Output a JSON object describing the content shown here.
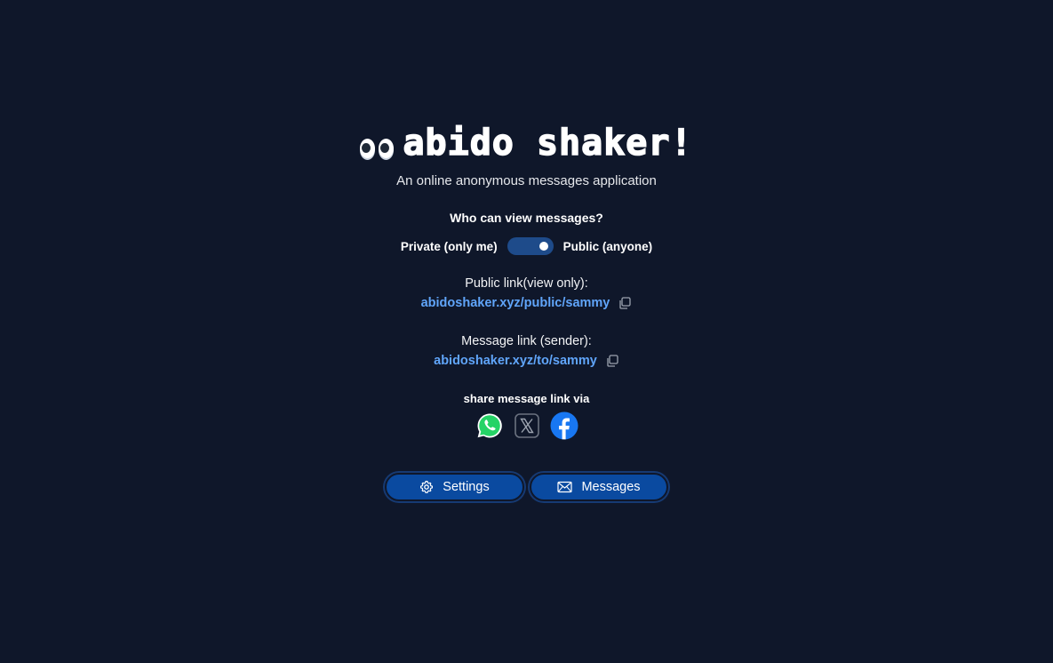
{
  "logo": {
    "text": "abido shaker!"
  },
  "tagline": "An online anonymous messages application",
  "visibility": {
    "question": "Who can view messages?",
    "private_label": "Private (only me)",
    "public_label": "Public (anyone)",
    "selected": "public"
  },
  "public_link": {
    "label": "Public link(view only):",
    "url": "abidoshaker.xyz/public/sammy",
    "icon": "copy-icon"
  },
  "message_link": {
    "label": "Message link (sender):",
    "url": "abidoshaker.xyz/to/sammy",
    "icon": "copy-icon"
  },
  "share": {
    "label": "share message link via",
    "targets": [
      {
        "name": "WhatsApp",
        "icon": "whatsapp-icon"
      },
      {
        "name": "X",
        "icon": "x-icon"
      },
      {
        "name": "Facebook",
        "icon": "facebook-icon"
      }
    ]
  },
  "actions": {
    "settings_label": "Settings",
    "settings_icon": "gear-icon",
    "messages_label": "Messages",
    "messages_icon": "envelope-icon"
  },
  "colors": {
    "background": "#0f172a",
    "link": "#60a5fa",
    "button": "#0a4aa0",
    "toggle": "#1e4b8a",
    "whatsapp": "#25d366",
    "facebook": "#1877f2"
  }
}
